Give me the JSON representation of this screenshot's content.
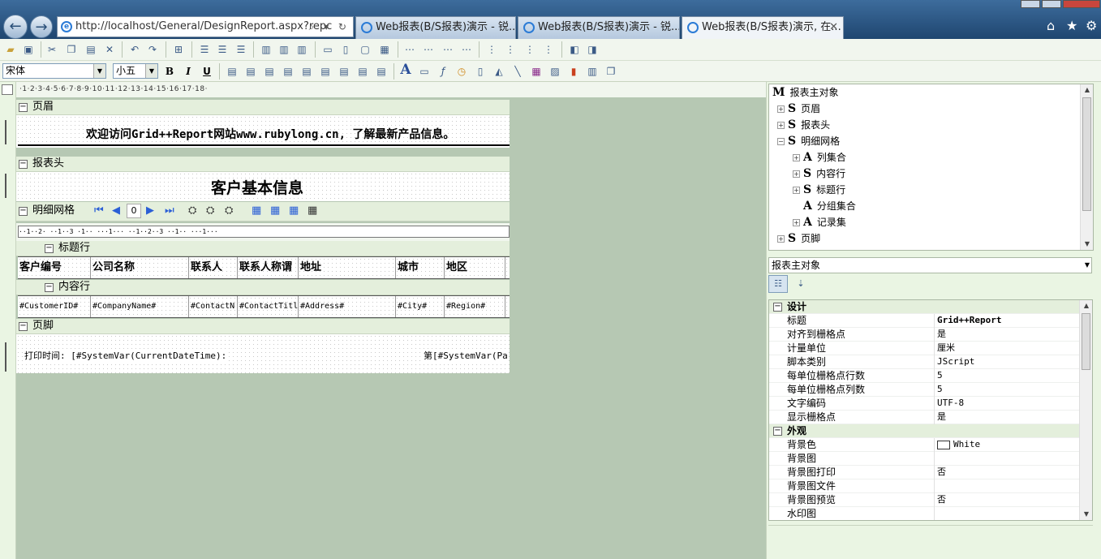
{
  "browser": {
    "address": "http://localhost/General/DesignReport.aspx?repc",
    "address_tools": "⌕ ▾ ↻",
    "tabs": [
      {
        "label": "Web报表(B/S报表)演示 - 锐..."
      },
      {
        "label": "Web报表(B/S报表)演示 - 锐..."
      },
      {
        "label": "Web报表(B/S报表)演示, 在..."
      }
    ],
    "tab_close": "✕"
  },
  "toolbar": {
    "font_name": "宋体",
    "font_size": "小五",
    "bold": "B",
    "italic": "I",
    "underline": "U"
  },
  "ruler": {
    "text": "·1·2·3·4·5·6·7·8·9·10·11·12·13·14·15·16·17·18·",
    "grid_ruler": "··1··2·  ··1··3  ·1··  ···1···  ··1··2··3  ··1··  ···1···"
  },
  "report": {
    "page_header": {
      "label": "页眉",
      "text": "欢迎访问Grid++Report网站www.rubylong.cn, 了解最新产品信息。"
    },
    "report_header": {
      "label": "报表头",
      "title": "客户基本信息"
    },
    "detail_grid": {
      "label": "明细网格",
      "page_value": "0",
      "title_row_label": "标题行",
      "content_row_label": "内容行",
      "columns": [
        "客户编号",
        "公司名称",
        "联系人",
        "联系人称谓",
        "地址",
        "城市",
        "地区"
      ],
      "fields": [
        "#CustomerID#",
        "#CompanyName#",
        "#ContactN",
        "#ContactTitl",
        "#Address#",
        "#City#",
        "#Region#"
      ]
    },
    "page_footer": {
      "label": "页脚",
      "left_text": "打印时间: [#SystemVar(CurrentDateTime):",
      "right_text": "第[#SystemVar(Pa"
    }
  },
  "tree": {
    "items": [
      {
        "glyph": "M",
        "label": "报表主对象"
      },
      {
        "glyph": "S",
        "label": "页眉"
      },
      {
        "glyph": "S",
        "label": "报表头"
      },
      {
        "glyph": "S",
        "label": "明细网格"
      },
      {
        "glyph": "A",
        "label": "列集合"
      },
      {
        "glyph": "S",
        "label": "内容行"
      },
      {
        "glyph": "S",
        "label": "标题行"
      },
      {
        "glyph": "A",
        "label": "分组集合"
      },
      {
        "glyph": "A",
        "label": "记录集"
      },
      {
        "glyph": "S",
        "label": "页脚"
      }
    ]
  },
  "property_panel": {
    "object": "报表主对象",
    "categories": [
      {
        "name": "设计",
        "props": [
          {
            "key": "标题",
            "value": "Grid++Report"
          },
          {
            "key": "对齐到栅格点",
            "value": "是"
          },
          {
            "key": "计量单位",
            "value": "厘米"
          },
          {
            "key": "脚本类别",
            "value": "JScript"
          },
          {
            "key": "每单位栅格点行数",
            "value": "5"
          },
          {
            "key": "每单位栅格点列数",
            "value": "5"
          },
          {
            "key": "文字编码",
            "value": "UTF-8"
          },
          {
            "key": "显示栅格点",
            "value": "是"
          }
        ]
      },
      {
        "name": "外观",
        "props": [
          {
            "key": "背景色",
            "value": "White"
          },
          {
            "key": "背景图",
            "value": ""
          },
          {
            "key": "背景图打印",
            "value": "否"
          },
          {
            "key": "背景图文件",
            "value": ""
          },
          {
            "key": "背景图预览",
            "value": "否"
          },
          {
            "key": "水印图",
            "value": ""
          }
        ]
      }
    ]
  }
}
